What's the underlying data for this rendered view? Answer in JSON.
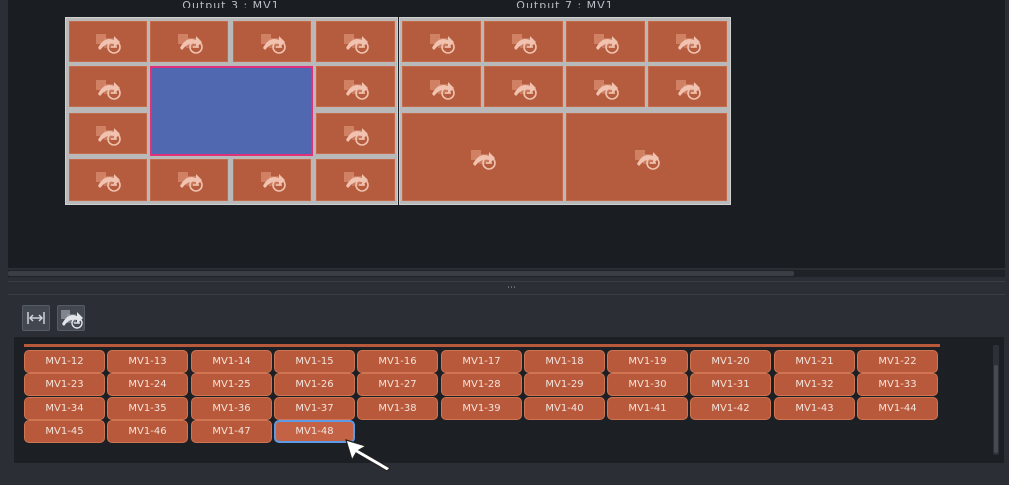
{
  "outputs": [
    {
      "title": "Output 3 : MV1"
    },
    {
      "title": "Output 7 : MV1"
    }
  ],
  "toolbar": {
    "fit_icon": "fit-width-icon",
    "source_icon": "source-link-icon"
  },
  "grid": {
    "rows": [
      [
        "MV1-12",
        "MV1-13",
        "MV1-14",
        "MV1-15",
        "MV1-16",
        "MV1-17",
        "MV1-18",
        "MV1-19",
        "MV1-20",
        "MV1-21",
        "MV1-22"
      ],
      [
        "MV1-23",
        "MV1-24",
        "MV1-25",
        "MV1-26",
        "MV1-27",
        "MV1-28",
        "MV1-29",
        "MV1-30",
        "MV1-31",
        "MV1-32",
        "MV1-33"
      ],
      [
        "MV1-34",
        "MV1-35",
        "MV1-36",
        "MV1-37",
        "MV1-38",
        "MV1-39",
        "MV1-40",
        "MV1-41",
        "MV1-42",
        "MV1-43",
        "MV1-44"
      ],
      [
        "MV1-45",
        "MV1-46",
        "MV1-47",
        "MV1-48"
      ]
    ],
    "selected": "MV1-48"
  },
  "colors": {
    "tile": "#b55c3e",
    "tile_selected": "#5068b0",
    "selection_border": "#e0307a",
    "button_focus": "#5e9ae6"
  }
}
